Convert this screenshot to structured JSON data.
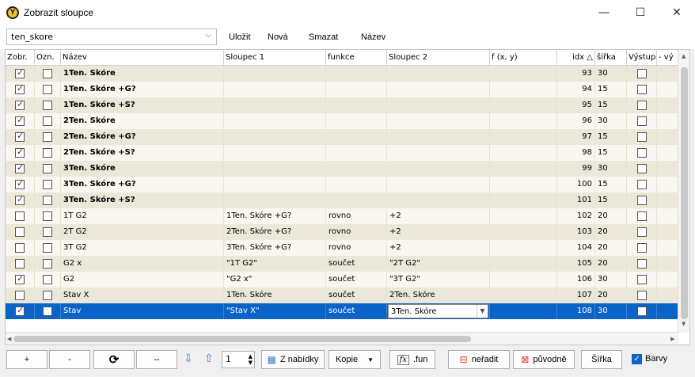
{
  "window": {
    "title": "Zobrazit sloupce",
    "minimize": "—",
    "maximize": "☐",
    "close": "✕"
  },
  "toolbar": {
    "combo_value": "ten_skore",
    "save": "Uložit",
    "new": "Nová",
    "delete": "Smazat",
    "name": "Název"
  },
  "columns": [
    "Zobr.",
    "Ozn.",
    "Název",
    "Sloupec 1",
    "funkce",
    "Sloupec 2",
    "f (x, y)",
    "idx △",
    "šířka",
    "Výstup",
    "- vý"
  ],
  "rows": [
    {
      "zobr": true,
      "ozn": false,
      "name": "1Ten. Skóre",
      "s1": "",
      "fn": "",
      "s2": "",
      "fxy": "",
      "idx": "93",
      "w": "30",
      "out": false,
      "bold": true
    },
    {
      "zobr": true,
      "ozn": false,
      "name": "1Ten. Skóre +G?",
      "s1": "",
      "fn": "",
      "s2": "",
      "fxy": "",
      "idx": "94",
      "w": "15",
      "out": false,
      "bold": true
    },
    {
      "zobr": true,
      "ozn": false,
      "name": "1Ten. Skóre +S?",
      "s1": "",
      "fn": "",
      "s2": "",
      "fxy": "",
      "idx": "95",
      "w": "15",
      "out": false,
      "bold": true
    },
    {
      "zobr": true,
      "ozn": false,
      "name": "2Ten. Skóre",
      "s1": "",
      "fn": "",
      "s2": "",
      "fxy": "",
      "idx": "96",
      "w": "30",
      "out": false,
      "bold": true
    },
    {
      "zobr": true,
      "ozn": false,
      "name": "2Ten. Skóre +G?",
      "s1": "",
      "fn": "",
      "s2": "",
      "fxy": "",
      "idx": "97",
      "w": "15",
      "out": false,
      "bold": true
    },
    {
      "zobr": true,
      "ozn": false,
      "name": "2Ten. Skóre +S?",
      "s1": "",
      "fn": "",
      "s2": "",
      "fxy": "",
      "idx": "98",
      "w": "15",
      "out": false,
      "bold": true
    },
    {
      "zobr": true,
      "ozn": false,
      "name": "3Ten. Skóre",
      "s1": "",
      "fn": "",
      "s2": "",
      "fxy": "",
      "idx": "99",
      "w": "30",
      "out": false,
      "bold": true
    },
    {
      "zobr": true,
      "ozn": false,
      "name": "3Ten. Skóre +G?",
      "s1": "",
      "fn": "",
      "s2": "",
      "fxy": "",
      "idx": "100",
      "w": "15",
      "out": false,
      "bold": true
    },
    {
      "zobr": true,
      "ozn": false,
      "name": "3Ten. Skóre +S?",
      "s1": "",
      "fn": "",
      "s2": "",
      "fxy": "",
      "idx": "101",
      "w": "15",
      "out": false,
      "bold": true
    },
    {
      "zobr": false,
      "ozn": false,
      "name": "1T G2",
      "s1": "1Ten. Skóre +G?",
      "fn": "rovno",
      "s2": "+2",
      "fxy": "",
      "idx": "102",
      "w": "20",
      "out": false,
      "bold": false
    },
    {
      "zobr": false,
      "ozn": false,
      "name": "2T G2",
      "s1": "2Ten. Skóre +G?",
      "fn": "rovno",
      "s2": "+2",
      "fxy": "",
      "idx": "103",
      "w": "20",
      "out": false,
      "bold": false
    },
    {
      "zobr": false,
      "ozn": false,
      "name": "3T G2",
      "s1": "3Ten. Skóre +G?",
      "fn": "rovno",
      "s2": "+2",
      "fxy": "",
      "idx": "104",
      "w": "20",
      "out": false,
      "bold": false
    },
    {
      "zobr": false,
      "ozn": false,
      "name": "G2 x",
      "s1": "\"1T G2\"",
      "fn": "součet",
      "s2": "\"2T G2\"",
      "fxy": "",
      "idx": "105",
      "w": "20",
      "out": false,
      "bold": false
    },
    {
      "zobr": true,
      "ozn": false,
      "name": "G2",
      "s1": "\"G2 x\"",
      "fn": "součet",
      "s2": "\"3T G2\"",
      "fxy": "",
      "idx": "106",
      "w": "30",
      "out": false,
      "bold": false
    },
    {
      "zobr": false,
      "ozn": false,
      "name": "Stav X",
      "s1": "1Ten. Skóre",
      "fn": "součet",
      "s2": "2Ten. Skóre",
      "fxy": "",
      "idx": "107",
      "w": "20",
      "out": false,
      "bold": false
    },
    {
      "zobr": true,
      "ozn": false,
      "name": "Stav",
      "s1": "\"Stav X\"",
      "fn": "součet",
      "s2": "3Ten. Skóre",
      "fxy": "",
      "idx": "108",
      "w": "30",
      "out": false,
      "bold": false,
      "selected": true
    }
  ],
  "bottom": {
    "plus": "+",
    "minus": "-",
    "refresh_icon": "⟳",
    "dashdash": "--",
    "spin_value": "1",
    "from_menu": "Z nabídky",
    "copy": "Kopie",
    "fx_label": ".fun",
    "fx_icon": "fx",
    "no_sort": "neřadit",
    "original": "původně",
    "width": "Šířka",
    "colors": "Barvy"
  },
  "colors": {
    "row_alt": "#ebe7d9",
    "row_base": "#f9f7f0",
    "selected": "#0a64c8"
  }
}
